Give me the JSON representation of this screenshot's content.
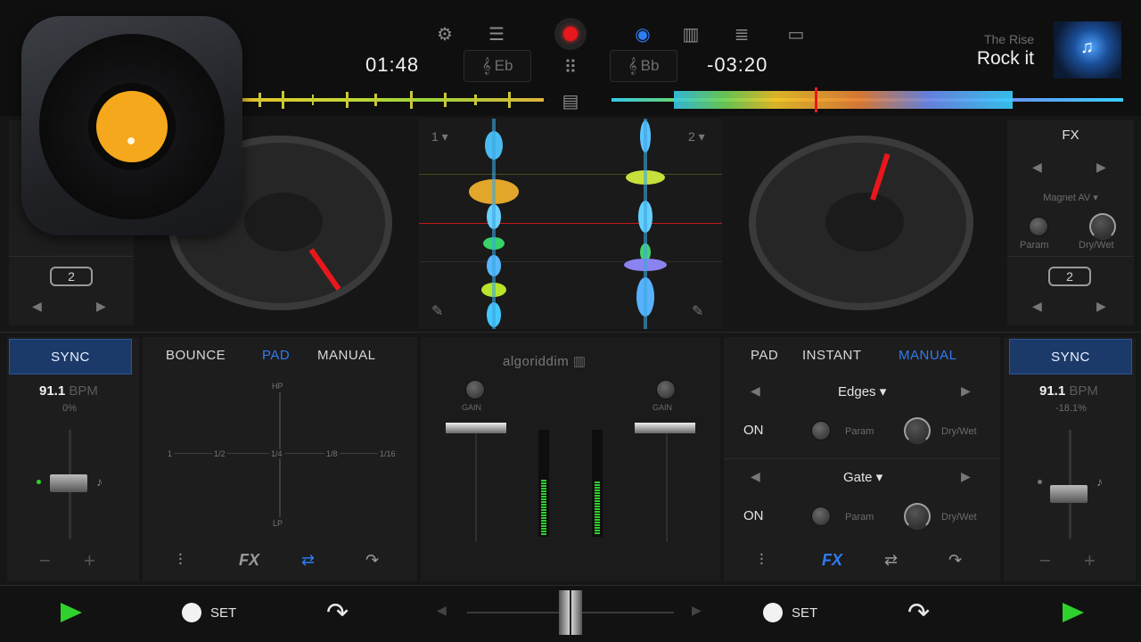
{
  "deck_left": {
    "time": "01:48",
    "key": "Eb",
    "loop_size": "2",
    "sync_label": "SYNC",
    "bpm_value": "91.1",
    "bpm_unit": "BPM",
    "pitch": "0%",
    "tabs": [
      "BOUNCE",
      "PAD",
      "MANUAL"
    ],
    "active_tab": "PAD",
    "xy_labels": {
      "top": "HP",
      "bottom": "LP",
      "marks": [
        "1",
        "1/2",
        "1/4",
        "1/8",
        "1/16"
      ]
    },
    "set_label": "SET"
  },
  "deck_right": {
    "time": "-03:20",
    "key": "Bb",
    "track_artist": "The Rise",
    "track_title": "Rock it",
    "loop_size": "2",
    "sync_label": "SYNC",
    "bpm_value": "91.1",
    "bpm_unit": "BPM",
    "pitch": "-18.1%",
    "tabs": [
      "PAD",
      "INSTANT",
      "MANUAL"
    ],
    "active_tab": "MANUAL",
    "fx_slots": [
      {
        "name": "Edges",
        "on_label": "ON",
        "param_label": "Param",
        "drywet_label": "Dry/Wet"
      },
      {
        "name": "Gate",
        "on_label": "ON",
        "param_label": "Param",
        "drywet_label": "Dry/Wet"
      }
    ],
    "set_label": "SET"
  },
  "fx_panel": {
    "title": "FX",
    "effect": "Magnet AV",
    "param_label": "Param",
    "drywet_label": "Dry/Wet"
  },
  "waveform": {
    "deck1_label": "1",
    "deck2_label": "2"
  },
  "mixer": {
    "brand": "algoriddim",
    "gain_label": "GAIN"
  },
  "colors": {
    "accent_blue": "#2f7bf2",
    "sync_bg": "#1c3a69",
    "play_green": "#2fd12c",
    "record_red": "#e8171b",
    "app_icon_label": "#f5a81c"
  }
}
